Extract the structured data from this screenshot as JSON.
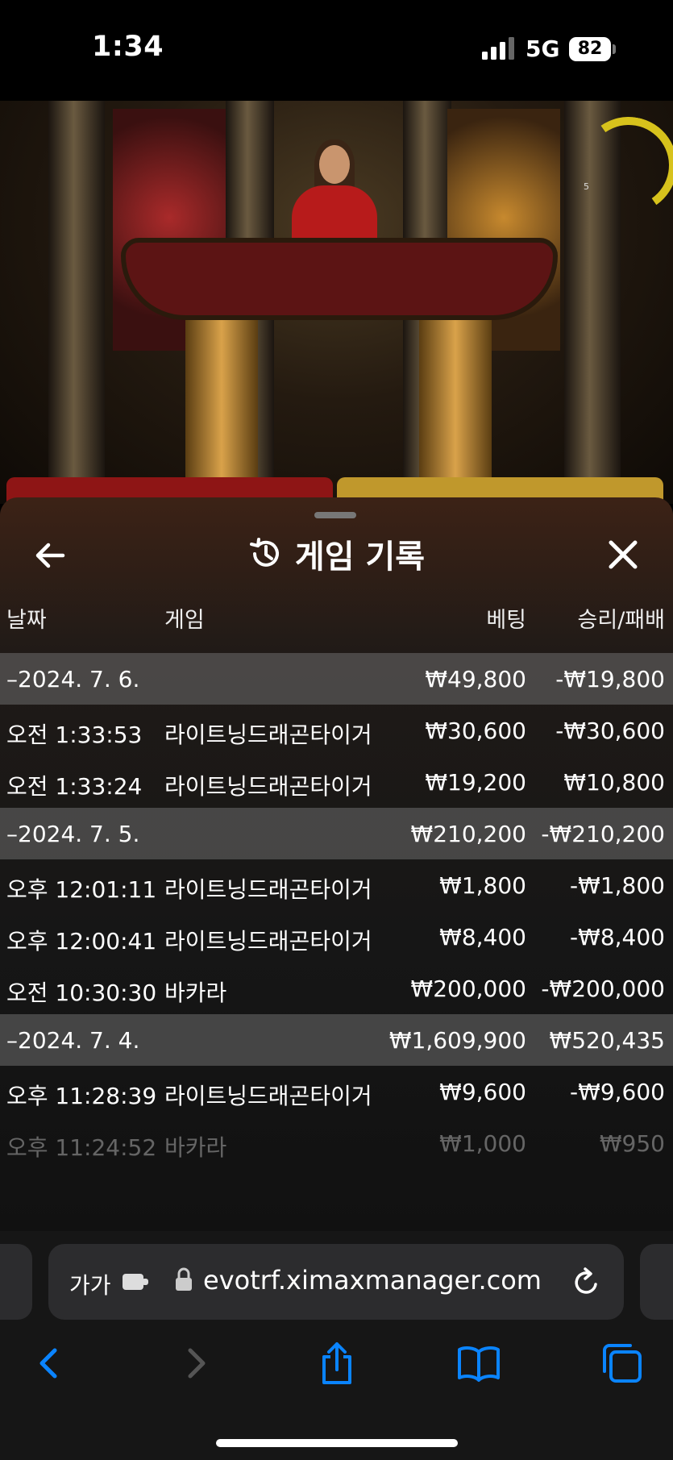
{
  "status_bar": {
    "time": "1:34",
    "network": "5G",
    "battery": "82"
  },
  "video": {
    "gauge_value": "5"
  },
  "sheet": {
    "title": "게임 기록",
    "columns": {
      "date": "날짜",
      "game": "게임",
      "bet": "베팅",
      "result": "승리/패배"
    },
    "rows": [
      {
        "kind": "date",
        "time": "–2024. 7. 6.",
        "game": "",
        "bet": "₩49,800",
        "result": "-₩19,800"
      },
      {
        "kind": "entry",
        "time": "오전 1:33:53",
        "game": "라이트닝드래곤타이거",
        "bet": "₩30,600",
        "result": "-₩30,600"
      },
      {
        "kind": "entry",
        "time": "오전 1:33:24",
        "game": "라이트닝드래곤타이거",
        "bet": "₩19,200",
        "result": "₩10,800"
      },
      {
        "kind": "date",
        "time": "–2024. 7. 5.",
        "game": "",
        "bet": "₩210,200",
        "result": "-₩210,200"
      },
      {
        "kind": "entry",
        "time": "오후 12:01:11",
        "game": "라이트닝드래곤타이거",
        "bet": "₩1,800",
        "result": "-₩1,800"
      },
      {
        "kind": "entry",
        "time": "오후 12:00:41",
        "game": "라이트닝드래곤타이거",
        "bet": "₩8,400",
        "result": "-₩8,400"
      },
      {
        "kind": "entry",
        "time": "오전 10:30:30",
        "game": "바카라",
        "bet": "₩200,000",
        "result": "-₩200,000"
      },
      {
        "kind": "date",
        "time": "–2024. 7. 4.",
        "game": "",
        "bet": "₩1,609,900",
        "result": "₩520,435"
      },
      {
        "kind": "entry",
        "time": "오후 11:28:39",
        "game": "라이트닝드래곤타이거",
        "bet": "₩9,600",
        "result": "-₩9,600"
      },
      {
        "kind": "entry",
        "time": "오후 11:24:52",
        "game": "바카라",
        "bet": "₩1,000",
        "result": "₩950"
      }
    ]
  },
  "browser": {
    "text_size": "가가",
    "url": "evotrf.ximaxmanager.com"
  },
  "icons": {
    "back": "arrow-left-icon",
    "close": "close-icon",
    "history": "history-icon",
    "lock": "lock-icon",
    "extension": "extension-icon",
    "reload": "reload-icon",
    "nav_back": "chevron-left-icon",
    "nav_forward": "chevron-right-icon",
    "share": "share-icon",
    "bookmarks": "book-icon",
    "tabs": "tabs-icon"
  },
  "colors": {
    "accent": "#0a84ff",
    "date_row": "#6e6e6e",
    "red_panel": "#8e1515",
    "gold_panel": "#c0982c"
  }
}
